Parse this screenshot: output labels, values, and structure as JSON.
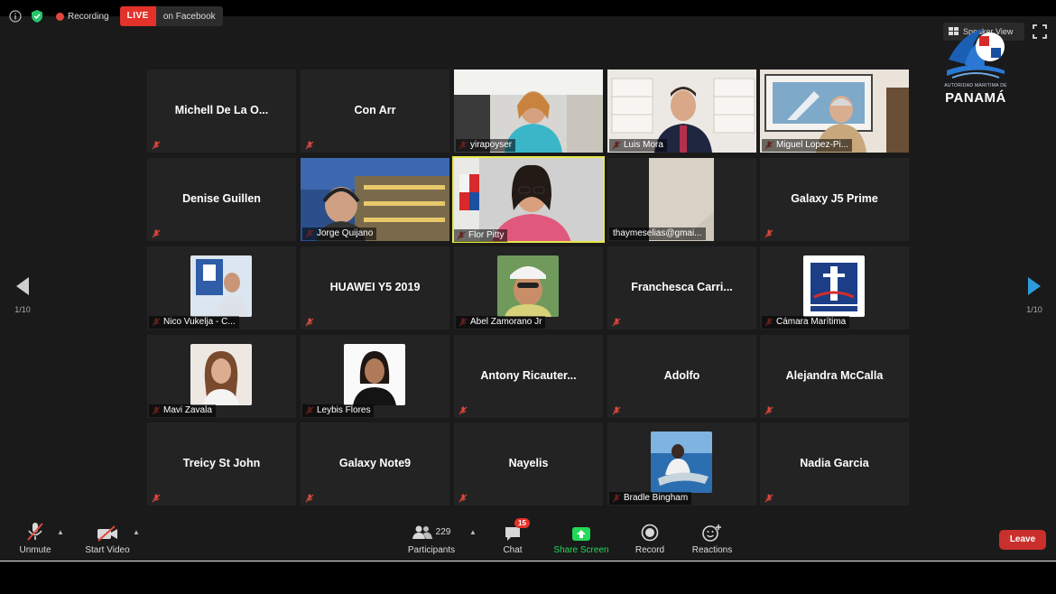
{
  "meeting": {
    "recording_label": "Recording",
    "live_badge": "LIVE",
    "live_platform": "on Facebook",
    "view_label": "Speaker View"
  },
  "logo": {
    "org_line": "AUTORIDAD MARITIMA DE",
    "name": "PANAMÁ"
  },
  "pagination": {
    "left_page": "1/10",
    "right_page": "1/10"
  },
  "tiles": [
    {
      "type": "name",
      "text": "Michell  De La O..."
    },
    {
      "type": "name",
      "text": "Con Arr"
    },
    {
      "type": "video",
      "label": "yirapoyser"
    },
    {
      "type": "video",
      "label": "Luis Mora"
    },
    {
      "type": "video",
      "label": "Miguel Lopez-Pi..."
    },
    {
      "type": "name",
      "text": "Denise Guillen"
    },
    {
      "type": "video",
      "label": "Jorge Quijano"
    },
    {
      "type": "video",
      "label": "Flor Pitty",
      "active": true
    },
    {
      "type": "video",
      "label": "thaymeselias@gmai..."
    },
    {
      "type": "name",
      "text": "Galaxy J5 Prime"
    },
    {
      "type": "photo",
      "label": "Nico Vukelja - C..."
    },
    {
      "type": "name",
      "text": "HUAWEI Y5 2019"
    },
    {
      "type": "photo",
      "label": "Abel Zamorano Jr"
    },
    {
      "type": "name",
      "text": "Franchesca  Carri..."
    },
    {
      "type": "photo",
      "label": "Cámara Marítima"
    },
    {
      "type": "photo",
      "label": "Mavi Zavala"
    },
    {
      "type": "photo",
      "label": "Leybis Flores"
    },
    {
      "type": "name",
      "text": "Antony  Ricauter..."
    },
    {
      "type": "name",
      "text": "Adolfo"
    },
    {
      "type": "name",
      "text": "Alejandra McCalla"
    },
    {
      "type": "name",
      "text": "Treicy St John"
    },
    {
      "type": "name",
      "text": "Galaxy Note9"
    },
    {
      "type": "name",
      "text": "Nayelis"
    },
    {
      "type": "photo",
      "label": "Bradle Bingham"
    },
    {
      "type": "name",
      "text": "Nadia Garcia"
    }
  ],
  "toolbar": {
    "unmute": "Unmute",
    "start_video": "Start Video",
    "participants": "Participants",
    "participants_count": "229",
    "chat": "Chat",
    "chat_badge": "15",
    "share_screen": "Share Screen",
    "record": "Record",
    "reactions": "Reactions",
    "leave": "Leave"
  },
  "colors": {
    "live_red": "#e3322a",
    "share_green": "#23d959",
    "active_speaker": "#e5e84a",
    "nav_arrow_blue": "#2d9cdb",
    "leave_red": "#c9302c"
  }
}
